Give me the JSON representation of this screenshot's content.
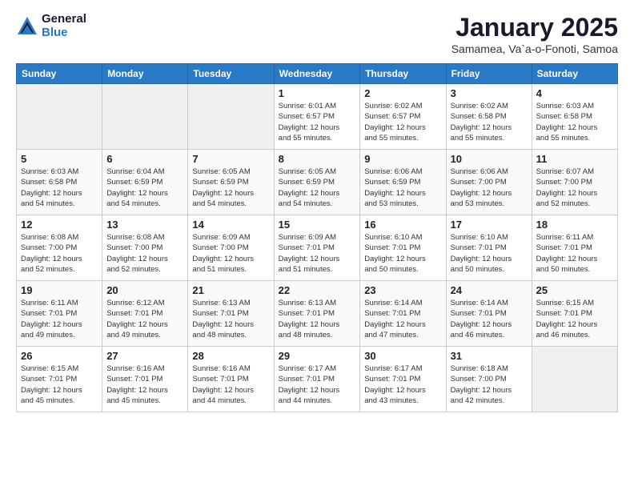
{
  "logo": {
    "general": "General",
    "blue": "Blue"
  },
  "title": "January 2025",
  "location": "Samamea, Va`a-o-Fonoti, Samoa",
  "days_of_week": [
    "Sunday",
    "Monday",
    "Tuesday",
    "Wednesday",
    "Thursday",
    "Friday",
    "Saturday"
  ],
  "weeks": [
    [
      {
        "day": "",
        "info": ""
      },
      {
        "day": "",
        "info": ""
      },
      {
        "day": "",
        "info": ""
      },
      {
        "day": "1",
        "info": "Sunrise: 6:01 AM\nSunset: 6:57 PM\nDaylight: 12 hours\nand 55 minutes."
      },
      {
        "day": "2",
        "info": "Sunrise: 6:02 AM\nSunset: 6:57 PM\nDaylight: 12 hours\nand 55 minutes."
      },
      {
        "day": "3",
        "info": "Sunrise: 6:02 AM\nSunset: 6:58 PM\nDaylight: 12 hours\nand 55 minutes."
      },
      {
        "day": "4",
        "info": "Sunrise: 6:03 AM\nSunset: 6:58 PM\nDaylight: 12 hours\nand 55 minutes."
      }
    ],
    [
      {
        "day": "5",
        "info": "Sunrise: 6:03 AM\nSunset: 6:58 PM\nDaylight: 12 hours\nand 54 minutes."
      },
      {
        "day": "6",
        "info": "Sunrise: 6:04 AM\nSunset: 6:59 PM\nDaylight: 12 hours\nand 54 minutes."
      },
      {
        "day": "7",
        "info": "Sunrise: 6:05 AM\nSunset: 6:59 PM\nDaylight: 12 hours\nand 54 minutes."
      },
      {
        "day": "8",
        "info": "Sunrise: 6:05 AM\nSunset: 6:59 PM\nDaylight: 12 hours\nand 54 minutes."
      },
      {
        "day": "9",
        "info": "Sunrise: 6:06 AM\nSunset: 6:59 PM\nDaylight: 12 hours\nand 53 minutes."
      },
      {
        "day": "10",
        "info": "Sunrise: 6:06 AM\nSunset: 7:00 PM\nDaylight: 12 hours\nand 53 minutes."
      },
      {
        "day": "11",
        "info": "Sunrise: 6:07 AM\nSunset: 7:00 PM\nDaylight: 12 hours\nand 52 minutes."
      }
    ],
    [
      {
        "day": "12",
        "info": "Sunrise: 6:08 AM\nSunset: 7:00 PM\nDaylight: 12 hours\nand 52 minutes."
      },
      {
        "day": "13",
        "info": "Sunrise: 6:08 AM\nSunset: 7:00 PM\nDaylight: 12 hours\nand 52 minutes."
      },
      {
        "day": "14",
        "info": "Sunrise: 6:09 AM\nSunset: 7:00 PM\nDaylight: 12 hours\nand 51 minutes."
      },
      {
        "day": "15",
        "info": "Sunrise: 6:09 AM\nSunset: 7:01 PM\nDaylight: 12 hours\nand 51 minutes."
      },
      {
        "day": "16",
        "info": "Sunrise: 6:10 AM\nSunset: 7:01 PM\nDaylight: 12 hours\nand 50 minutes."
      },
      {
        "day": "17",
        "info": "Sunrise: 6:10 AM\nSunset: 7:01 PM\nDaylight: 12 hours\nand 50 minutes."
      },
      {
        "day": "18",
        "info": "Sunrise: 6:11 AM\nSunset: 7:01 PM\nDaylight: 12 hours\nand 50 minutes."
      }
    ],
    [
      {
        "day": "19",
        "info": "Sunrise: 6:11 AM\nSunset: 7:01 PM\nDaylight: 12 hours\nand 49 minutes."
      },
      {
        "day": "20",
        "info": "Sunrise: 6:12 AM\nSunset: 7:01 PM\nDaylight: 12 hours\nand 49 minutes."
      },
      {
        "day": "21",
        "info": "Sunrise: 6:13 AM\nSunset: 7:01 PM\nDaylight: 12 hours\nand 48 minutes."
      },
      {
        "day": "22",
        "info": "Sunrise: 6:13 AM\nSunset: 7:01 PM\nDaylight: 12 hours\nand 48 minutes."
      },
      {
        "day": "23",
        "info": "Sunrise: 6:14 AM\nSunset: 7:01 PM\nDaylight: 12 hours\nand 47 minutes."
      },
      {
        "day": "24",
        "info": "Sunrise: 6:14 AM\nSunset: 7:01 PM\nDaylight: 12 hours\nand 46 minutes."
      },
      {
        "day": "25",
        "info": "Sunrise: 6:15 AM\nSunset: 7:01 PM\nDaylight: 12 hours\nand 46 minutes."
      }
    ],
    [
      {
        "day": "26",
        "info": "Sunrise: 6:15 AM\nSunset: 7:01 PM\nDaylight: 12 hours\nand 45 minutes."
      },
      {
        "day": "27",
        "info": "Sunrise: 6:16 AM\nSunset: 7:01 PM\nDaylight: 12 hours\nand 45 minutes."
      },
      {
        "day": "28",
        "info": "Sunrise: 6:16 AM\nSunset: 7:01 PM\nDaylight: 12 hours\nand 44 minutes."
      },
      {
        "day": "29",
        "info": "Sunrise: 6:17 AM\nSunset: 7:01 PM\nDaylight: 12 hours\nand 44 minutes."
      },
      {
        "day": "30",
        "info": "Sunrise: 6:17 AM\nSunset: 7:01 PM\nDaylight: 12 hours\nand 43 minutes."
      },
      {
        "day": "31",
        "info": "Sunrise: 6:18 AM\nSunset: 7:00 PM\nDaylight: 12 hours\nand 42 minutes."
      },
      {
        "day": "",
        "info": ""
      }
    ]
  ]
}
